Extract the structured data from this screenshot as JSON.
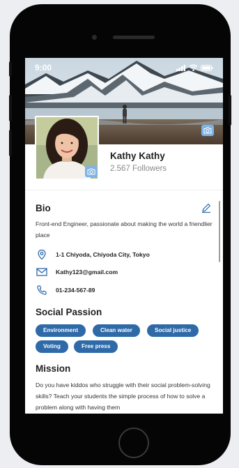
{
  "status_bar": {
    "time": "9:00"
  },
  "profile": {
    "name": "Kathy Kathy",
    "followers": "2.567 Followers"
  },
  "bio": {
    "title": "Bio",
    "text": "Front-end Engineer, passionate about making the world a friendlier place",
    "address": "1-1 Chiyoda, Chiyoda City, Tokyo",
    "email": "Kathy123@gmail.com",
    "phone": "01-234-567-89"
  },
  "social_passion": {
    "title": "Social Passion",
    "tags": [
      "Environment",
      "Clean water",
      "Social justice",
      "Voting",
      "Free press"
    ]
  },
  "mission": {
    "title": "Mission",
    "text": "Do you have kiddos who struggle with their social problem-solving skills? Teach your students the simple process of how to solve a problem along with having them"
  },
  "colors": {
    "accent": "#2e6aa8",
    "camera_badge": "#7fb3e3",
    "frame": "#050505"
  }
}
